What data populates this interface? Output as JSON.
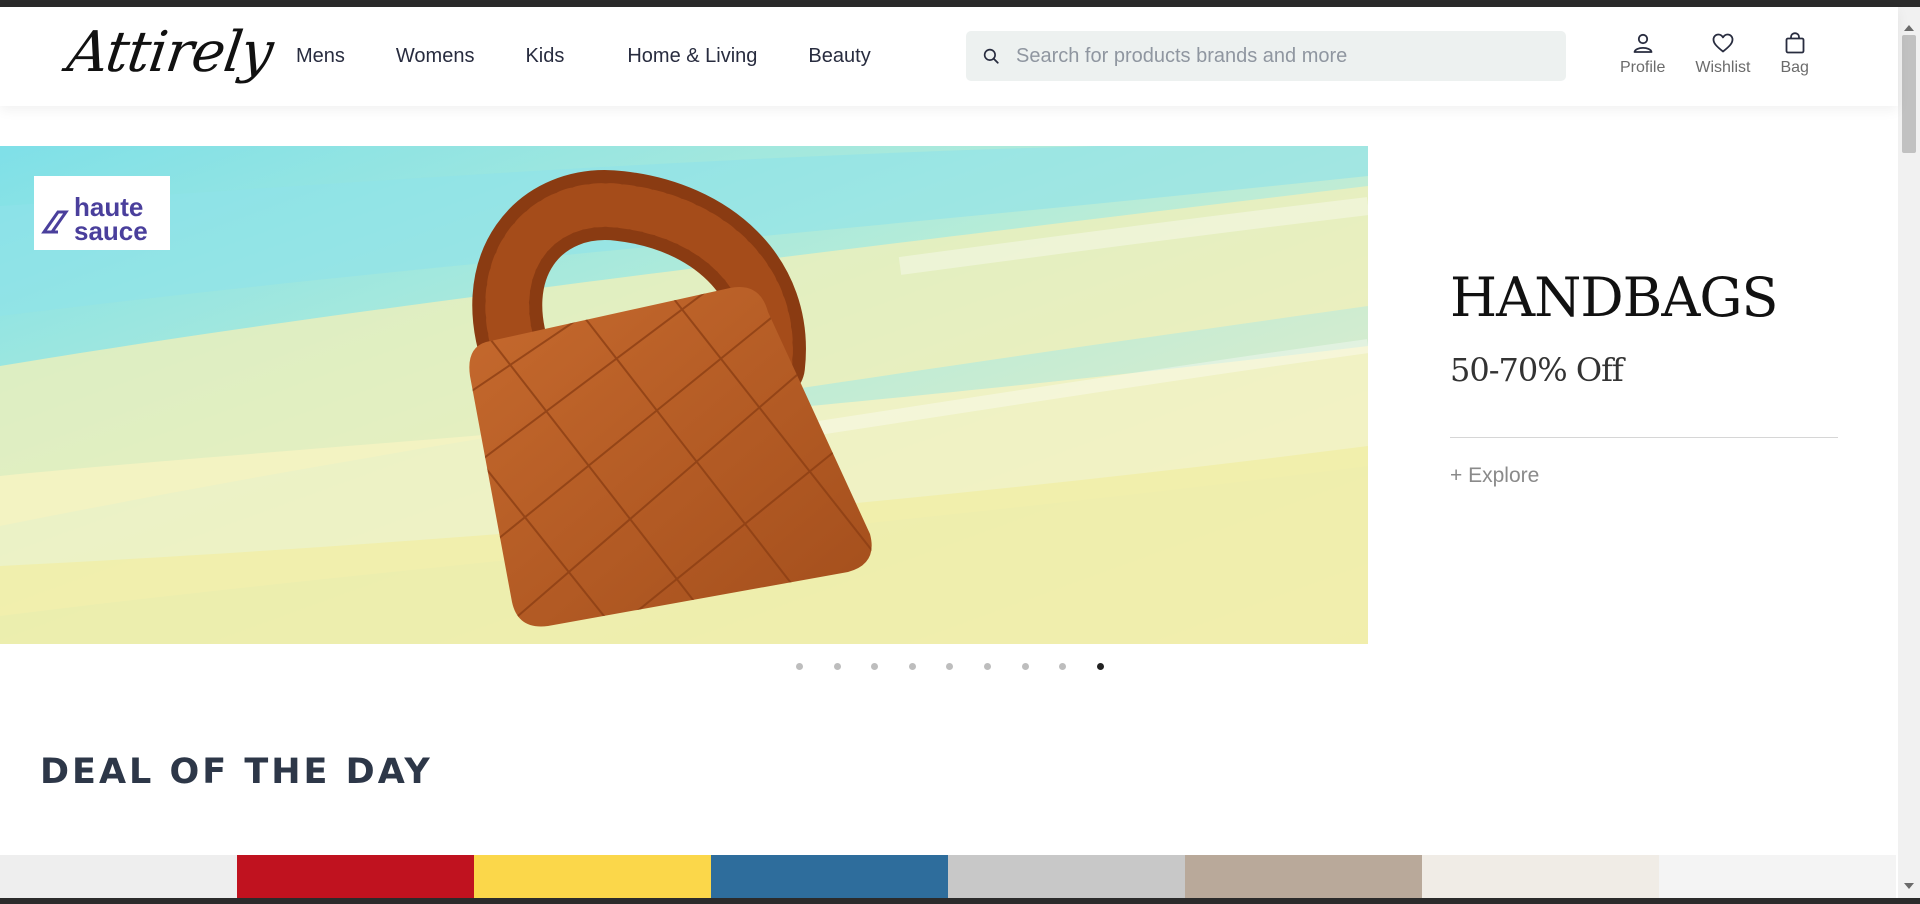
{
  "header": {
    "logo_text": "Attirely",
    "nav": [
      "Mens",
      "Womens",
      "Kids",
      "Home & Living",
      "Beauty"
    ],
    "search": {
      "placeholder": "Search for products brands and more"
    },
    "actions": [
      {
        "label": "Profile",
        "icon": "person-icon"
      },
      {
        "label": "Wishlist",
        "icon": "heart-icon"
      },
      {
        "label": "Bag",
        "icon": "bag-icon"
      }
    ]
  },
  "hero": {
    "brand_logo_text": [
      "haute",
      "sauce"
    ],
    "title": "HANDBAGS",
    "discount": "50-70% Off",
    "cta": "+ Explore",
    "slide_count": 9,
    "active_slide": 9
  },
  "deal_of_day": {
    "title": "DEAL OF THE DAY",
    "tile_colors": [
      "#eeeeee",
      "#c0121f",
      "#fbd74a",
      "#2e6d9c",
      "#c8c8c8",
      "#b9a99a",
      "#f0ece6",
      "#f4f4f4"
    ]
  },
  "colors": {
    "accent": "#111111",
    "search_bg": "#edf1f0",
    "text": "#282c3f"
  }
}
